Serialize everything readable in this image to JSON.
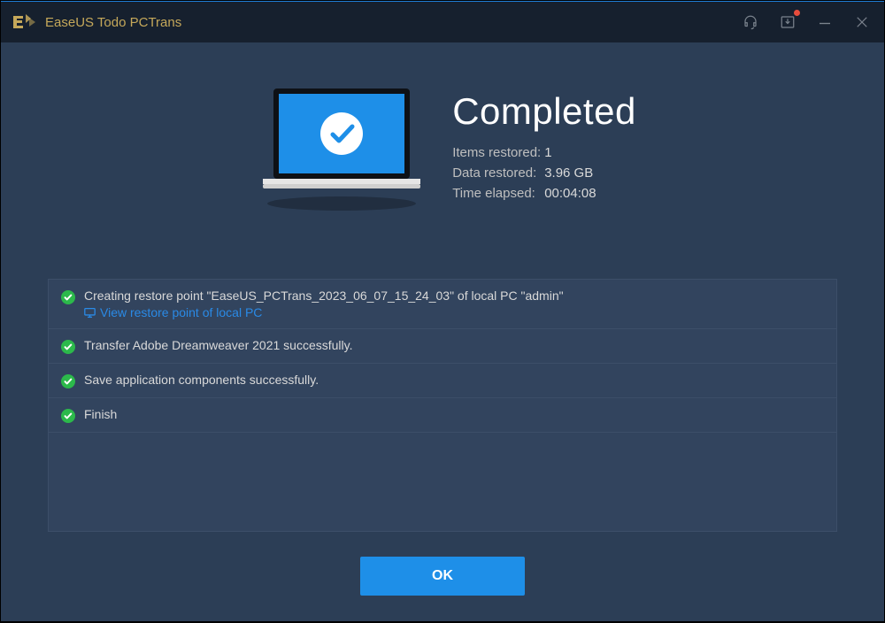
{
  "titlebar": {
    "app_title": "EaseUS Todo PCTrans"
  },
  "hero": {
    "completed_title": "Completed",
    "rows": [
      {
        "label": "Items restored:",
        "value": "1"
      },
      {
        "label": "Data restored:",
        "value": "3.96 GB"
      },
      {
        "label": "Time elapsed:",
        "value": "00:04:08"
      }
    ]
  },
  "list": {
    "items": [
      {
        "text": "Creating restore point \"EaseUS_PCTrans_2023_06_07_15_24_03\" of local PC \"admin\"",
        "sublink": "View restore point of local PC"
      },
      {
        "text": "Transfer Adobe Dreamweaver 2021 successfully."
      },
      {
        "text": "Save application components successfully."
      },
      {
        "text": "Finish"
      }
    ]
  },
  "footer": {
    "ok_label": "OK"
  }
}
